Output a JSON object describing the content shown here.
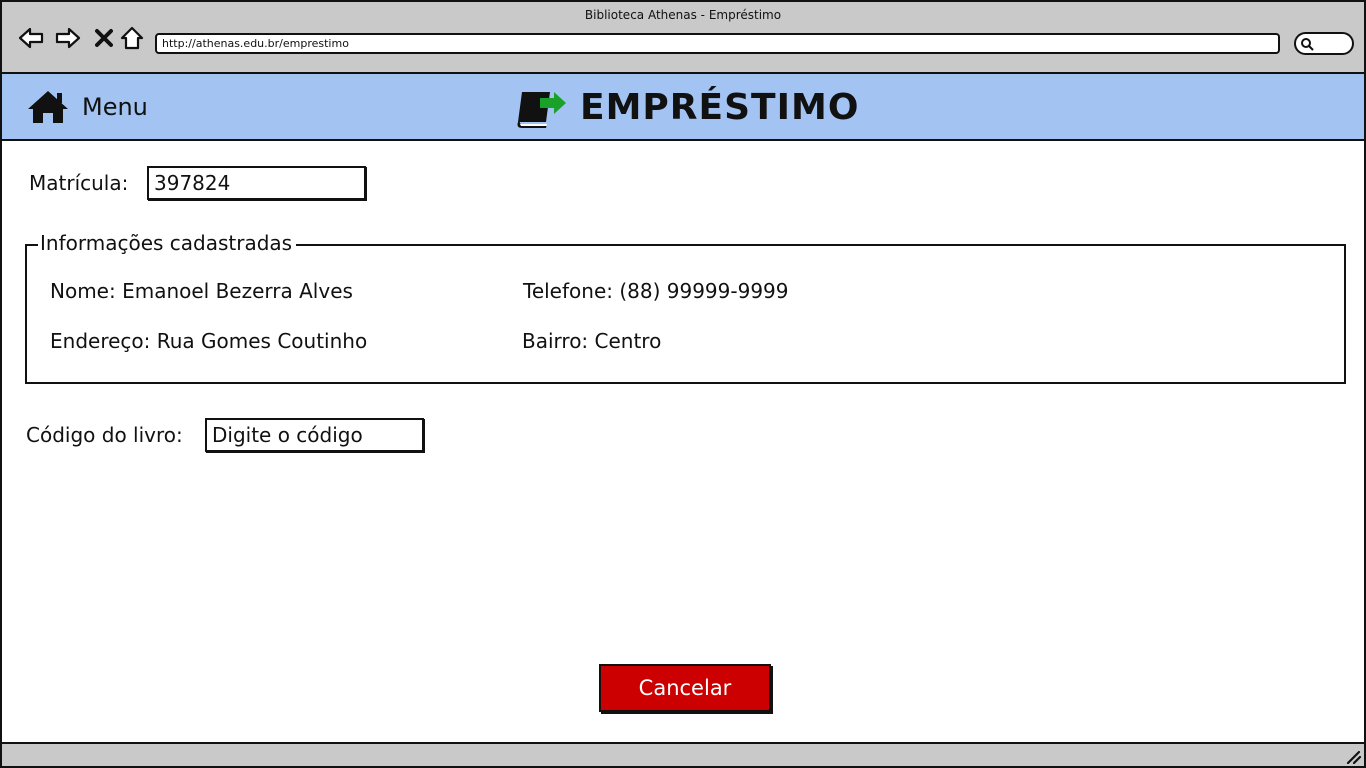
{
  "window": {
    "title": "Biblioteca Athenas - Empréstimo",
    "url": "http://athenas.edu.br/emprestimo"
  },
  "header": {
    "menu_label": "Menu",
    "page_title": "EMPRÉSTIMO"
  },
  "colors": {
    "header_bg": "#a3c4f3",
    "cancel_bg": "#cc0000",
    "icon_arrow": "#1aa12a"
  },
  "form": {
    "matricula_label": "Matrícula:",
    "matricula_value": "397824",
    "info_legend": "Informações cadastradas",
    "nome": "Nome: Emanoel Bezerra Alves",
    "telefone": "Telefone: (88) 99999-9999",
    "endereco": "Endereço: Rua Gomes Coutinho",
    "bairro": "Bairro: Centro",
    "codigo_label": "Código do livro:",
    "codigo_placeholder": "Digite o código"
  },
  "actions": {
    "cancel_label": "Cancelar"
  }
}
